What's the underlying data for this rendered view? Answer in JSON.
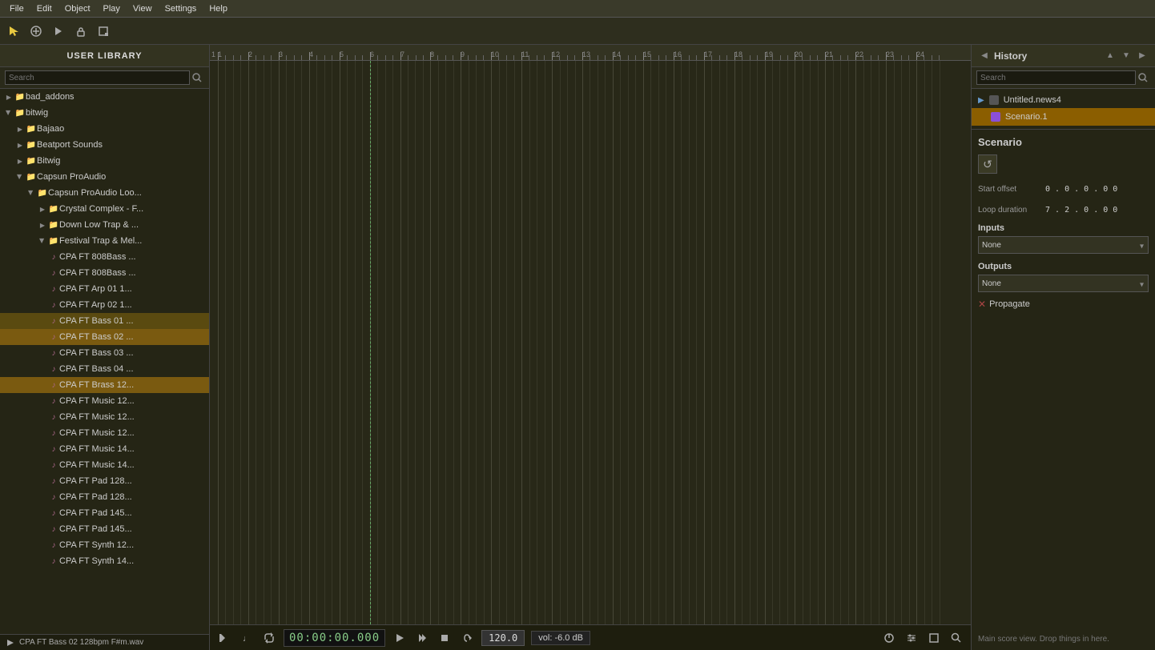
{
  "menubar": {
    "items": [
      "File",
      "Edit",
      "Object",
      "Play",
      "View",
      "Settings",
      "Help"
    ]
  },
  "toolbar": {
    "tools": [
      {
        "name": "select-tool",
        "icon": "▶",
        "label": "Select"
      },
      {
        "name": "add-tool",
        "icon": "+",
        "label": "Add"
      },
      {
        "name": "play-tool",
        "icon": "▷",
        "label": "Play"
      },
      {
        "name": "lock-tool",
        "icon": "🔒",
        "label": "Lock"
      },
      {
        "name": "resize-tool",
        "icon": "⬜",
        "label": "Resize"
      }
    ]
  },
  "left_panel": {
    "title": "USER LIBRARY",
    "search_placeholder": "Search",
    "tree": [
      {
        "id": "bad_addons",
        "label": "bad_addons",
        "level": 0,
        "expanded": false,
        "type": "folder"
      },
      {
        "id": "bitwig",
        "label": "bitwig",
        "level": 0,
        "expanded": true,
        "type": "folder"
      },
      {
        "id": "bajaao",
        "label": "Bajaao",
        "level": 1,
        "expanded": false,
        "type": "folder"
      },
      {
        "id": "beatport_sounds",
        "label": "Beatport Sounds",
        "level": 1,
        "expanded": false,
        "type": "folder"
      },
      {
        "id": "bitwig_sub",
        "label": "Bitwig",
        "level": 1,
        "expanded": false,
        "type": "folder"
      },
      {
        "id": "capsun_pro_audio",
        "label": "Capsun ProAudio",
        "level": 1,
        "expanded": true,
        "type": "folder"
      },
      {
        "id": "capsun_loops",
        "label": "Capsun ProAudio Loo...",
        "level": 2,
        "expanded": true,
        "type": "folder"
      },
      {
        "id": "crystal_complex",
        "label": "Crystal Complex - F...",
        "level": 3,
        "expanded": false,
        "type": "folder"
      },
      {
        "id": "down_low_trap",
        "label": "Down Low Trap & ...",
        "level": 3,
        "expanded": false,
        "type": "folder"
      },
      {
        "id": "festival_trap_mel",
        "label": "Festival Trap & Mel...",
        "level": 3,
        "expanded": true,
        "type": "folder"
      },
      {
        "id": "cpa_ft_808bass_1",
        "label": "CPA FT 808Bass ...",
        "level": 4,
        "type": "audio"
      },
      {
        "id": "cpa_ft_808bass_2",
        "label": "CPA FT 808Bass ...",
        "level": 4,
        "type": "audio"
      },
      {
        "id": "cpa_ft_arp_01",
        "label": "CPA FT Arp 01 1...",
        "level": 4,
        "type": "audio"
      },
      {
        "id": "cpa_ft_arp_02",
        "label": "CPA FT Arp 02 1...",
        "level": 4,
        "type": "audio"
      },
      {
        "id": "cpa_ft_bass_01",
        "label": "CPA FT Bass 01 ...",
        "level": 4,
        "type": "audio",
        "selected": true
      },
      {
        "id": "cpa_ft_bass_02",
        "label": "CPA FT Bass 02 ...",
        "level": 4,
        "type": "audio",
        "highlighted": true
      },
      {
        "id": "cpa_ft_bass_03",
        "label": "CPA FT Bass 03 ...",
        "level": 4,
        "type": "audio"
      },
      {
        "id": "cpa_ft_bass_04",
        "label": "CPA FT Bass 04 ...",
        "level": 4,
        "type": "audio"
      },
      {
        "id": "cpa_ft_brass_12",
        "label": "CPA FT Brass 12...",
        "level": 4,
        "type": "audio",
        "highlighted": true
      },
      {
        "id": "cpa_ft_music_12_1",
        "label": "CPA FT Music 12...",
        "level": 4,
        "type": "audio"
      },
      {
        "id": "cpa_ft_music_12_2",
        "label": "CPA FT Music 12...",
        "level": 4,
        "type": "audio"
      },
      {
        "id": "cpa_ft_music_12_3",
        "label": "CPA FT Music 12...",
        "level": 4,
        "type": "audio"
      },
      {
        "id": "cpa_ft_music_14_1",
        "label": "CPA FT Music 14...",
        "level": 4,
        "type": "audio"
      },
      {
        "id": "cpa_ft_music_14_2",
        "label": "CPA FT Music 14...",
        "level": 4,
        "type": "audio"
      },
      {
        "id": "cpa_ft_pad_128_1",
        "label": "CPA FT Pad 128...",
        "level": 4,
        "type": "audio"
      },
      {
        "id": "cpa_ft_pad_128_2",
        "label": "CPA FT Pad 128...",
        "level": 4,
        "type": "audio"
      },
      {
        "id": "cpa_ft_pad_145_1",
        "label": "CPA FT Pad 145...",
        "level": 4,
        "type": "audio"
      },
      {
        "id": "cpa_ft_pad_145_2",
        "label": "CPA FT Pad 145...",
        "level": 4,
        "type": "audio"
      },
      {
        "id": "cpa_ft_synth_12_1",
        "label": "CPA FT Synth 12...",
        "level": 4,
        "type": "audio"
      },
      {
        "id": "cpa_ft_synth_14_1",
        "label": "CPA FT Synth 14...",
        "level": 4,
        "type": "audio"
      }
    ],
    "bottom_file": "CPA FT Bass 02 128bpm F#m.wav"
  },
  "timeline": {
    "markers": [
      "1",
      "2",
      "3",
      "4",
      "5",
      "6",
      "7",
      "8",
      "9",
      "10",
      "11",
      "12",
      "13",
      "14",
      "15",
      "16",
      "17",
      "18",
      "19",
      "20",
      "21",
      "22",
      "23",
      "24"
    ]
  },
  "transport": {
    "time": "00:00:00.000",
    "tempo": "120.0",
    "volume": "vol: -6.0 dB"
  },
  "right_panel": {
    "title": "History",
    "search_placeholder": "Search",
    "history_tree": [
      {
        "id": "untitled_news4",
        "label": "Untitled.news4",
        "level": 0,
        "type": "file"
      },
      {
        "id": "scenario1",
        "label": "Scenario.1",
        "level": 1,
        "type": "scenario",
        "color": "#8b4fd8",
        "selected": true
      }
    ],
    "scenario": {
      "title": "Scenario",
      "loop_label": "Loop",
      "start_offset_label": "Start offset",
      "start_offset_value": "0 . 0 . 0 . 0 0",
      "loop_duration_label": "Loop duration",
      "loop_duration_value": "7 . 2 . 0 . 0 0",
      "inputs_label": "Inputs",
      "inputs_value": "None",
      "outputs_label": "Outputs",
      "outputs_value": "None",
      "propagate_label": "Propagate"
    },
    "drop_hint": "Main score view. Drop things in here."
  },
  "bottom_toolbar": {
    "items": [
      {
        "name": "piano-roll-icon",
        "icon": "🎵"
      },
      {
        "name": "note-icon",
        "icon": "♩"
      },
      {
        "name": "curve-icon",
        "icon": "↗"
      },
      {
        "name": "history-btn",
        "icon": "↩"
      },
      {
        "name": "grid-btn",
        "icon": "⊞"
      },
      {
        "name": "folder-btn",
        "icon": "📁"
      },
      {
        "name": "power-btn",
        "icon": "⏻"
      },
      {
        "name": "mixer-btn",
        "icon": "≡"
      },
      {
        "name": "expand-btn",
        "icon": "⬛"
      },
      {
        "name": "search-btn",
        "icon": "🔍"
      }
    ]
  }
}
